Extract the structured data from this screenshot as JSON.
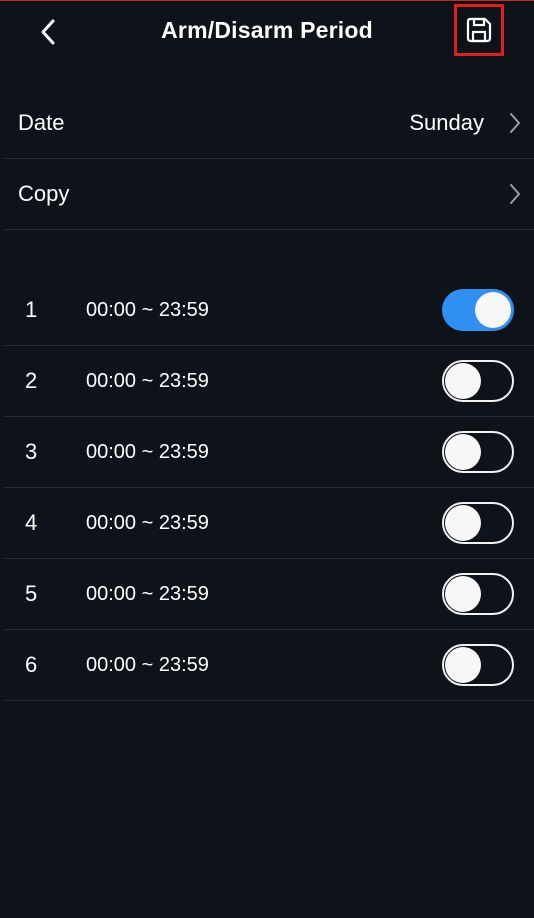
{
  "header": {
    "title": "Arm/Disarm Period",
    "back_icon": "chevron-left-icon",
    "save_icon": "save-icon"
  },
  "settings": {
    "date_label": "Date",
    "date_value": "Sunday",
    "copy_label": "Copy"
  },
  "periods": [
    {
      "index": "1",
      "time": "00:00 ~ 23:59",
      "enabled": true
    },
    {
      "index": "2",
      "time": "00:00 ~ 23:59",
      "enabled": false
    },
    {
      "index": "3",
      "time": "00:00 ~ 23:59",
      "enabled": false
    },
    {
      "index": "4",
      "time": "00:00 ~ 23:59",
      "enabled": false
    },
    {
      "index": "5",
      "time": "00:00 ~ 23:59",
      "enabled": false
    },
    {
      "index": "6",
      "time": "00:00 ~ 23:59",
      "enabled": false
    }
  ],
  "colors": {
    "background": "#0e131a",
    "toggle_on": "#2f8ff2",
    "save_highlight": "#e11d1d"
  }
}
